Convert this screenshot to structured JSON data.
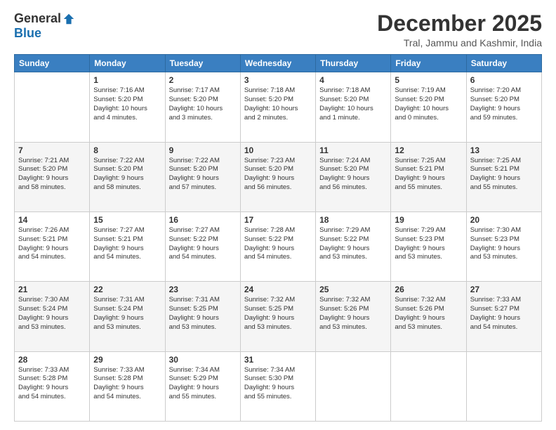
{
  "header": {
    "logo_general": "General",
    "logo_blue": "Blue",
    "month": "December 2025",
    "location": "Tral, Jammu and Kashmir, India"
  },
  "days_of_week": [
    "Sunday",
    "Monday",
    "Tuesday",
    "Wednesday",
    "Thursday",
    "Friday",
    "Saturday"
  ],
  "weeks": [
    [
      {
        "day": "",
        "info": ""
      },
      {
        "day": "1",
        "info": "Sunrise: 7:16 AM\nSunset: 5:20 PM\nDaylight: 10 hours\nand 4 minutes."
      },
      {
        "day": "2",
        "info": "Sunrise: 7:17 AM\nSunset: 5:20 PM\nDaylight: 10 hours\nand 3 minutes."
      },
      {
        "day": "3",
        "info": "Sunrise: 7:18 AM\nSunset: 5:20 PM\nDaylight: 10 hours\nand 2 minutes."
      },
      {
        "day": "4",
        "info": "Sunrise: 7:18 AM\nSunset: 5:20 PM\nDaylight: 10 hours\nand 1 minute."
      },
      {
        "day": "5",
        "info": "Sunrise: 7:19 AM\nSunset: 5:20 PM\nDaylight: 10 hours\nand 0 minutes."
      },
      {
        "day": "6",
        "info": "Sunrise: 7:20 AM\nSunset: 5:20 PM\nDaylight: 9 hours\nand 59 minutes."
      }
    ],
    [
      {
        "day": "7",
        "info": "Sunrise: 7:21 AM\nSunset: 5:20 PM\nDaylight: 9 hours\nand 58 minutes."
      },
      {
        "day": "8",
        "info": "Sunrise: 7:22 AM\nSunset: 5:20 PM\nDaylight: 9 hours\nand 58 minutes."
      },
      {
        "day": "9",
        "info": "Sunrise: 7:22 AM\nSunset: 5:20 PM\nDaylight: 9 hours\nand 57 minutes."
      },
      {
        "day": "10",
        "info": "Sunrise: 7:23 AM\nSunset: 5:20 PM\nDaylight: 9 hours\nand 56 minutes."
      },
      {
        "day": "11",
        "info": "Sunrise: 7:24 AM\nSunset: 5:20 PM\nDaylight: 9 hours\nand 56 minutes."
      },
      {
        "day": "12",
        "info": "Sunrise: 7:25 AM\nSunset: 5:21 PM\nDaylight: 9 hours\nand 55 minutes."
      },
      {
        "day": "13",
        "info": "Sunrise: 7:25 AM\nSunset: 5:21 PM\nDaylight: 9 hours\nand 55 minutes."
      }
    ],
    [
      {
        "day": "14",
        "info": "Sunrise: 7:26 AM\nSunset: 5:21 PM\nDaylight: 9 hours\nand 54 minutes."
      },
      {
        "day": "15",
        "info": "Sunrise: 7:27 AM\nSunset: 5:21 PM\nDaylight: 9 hours\nand 54 minutes."
      },
      {
        "day": "16",
        "info": "Sunrise: 7:27 AM\nSunset: 5:22 PM\nDaylight: 9 hours\nand 54 minutes."
      },
      {
        "day": "17",
        "info": "Sunrise: 7:28 AM\nSunset: 5:22 PM\nDaylight: 9 hours\nand 54 minutes."
      },
      {
        "day": "18",
        "info": "Sunrise: 7:29 AM\nSunset: 5:22 PM\nDaylight: 9 hours\nand 53 minutes."
      },
      {
        "day": "19",
        "info": "Sunrise: 7:29 AM\nSunset: 5:23 PM\nDaylight: 9 hours\nand 53 minutes."
      },
      {
        "day": "20",
        "info": "Sunrise: 7:30 AM\nSunset: 5:23 PM\nDaylight: 9 hours\nand 53 minutes."
      }
    ],
    [
      {
        "day": "21",
        "info": "Sunrise: 7:30 AM\nSunset: 5:24 PM\nDaylight: 9 hours\nand 53 minutes."
      },
      {
        "day": "22",
        "info": "Sunrise: 7:31 AM\nSunset: 5:24 PM\nDaylight: 9 hours\nand 53 minutes."
      },
      {
        "day": "23",
        "info": "Sunrise: 7:31 AM\nSunset: 5:25 PM\nDaylight: 9 hours\nand 53 minutes."
      },
      {
        "day": "24",
        "info": "Sunrise: 7:32 AM\nSunset: 5:25 PM\nDaylight: 9 hours\nand 53 minutes."
      },
      {
        "day": "25",
        "info": "Sunrise: 7:32 AM\nSunset: 5:26 PM\nDaylight: 9 hours\nand 53 minutes."
      },
      {
        "day": "26",
        "info": "Sunrise: 7:32 AM\nSunset: 5:26 PM\nDaylight: 9 hours\nand 53 minutes."
      },
      {
        "day": "27",
        "info": "Sunrise: 7:33 AM\nSunset: 5:27 PM\nDaylight: 9 hours\nand 54 minutes."
      }
    ],
    [
      {
        "day": "28",
        "info": "Sunrise: 7:33 AM\nSunset: 5:28 PM\nDaylight: 9 hours\nand 54 minutes."
      },
      {
        "day": "29",
        "info": "Sunrise: 7:33 AM\nSunset: 5:28 PM\nDaylight: 9 hours\nand 54 minutes."
      },
      {
        "day": "30",
        "info": "Sunrise: 7:34 AM\nSunset: 5:29 PM\nDaylight: 9 hours\nand 55 minutes."
      },
      {
        "day": "31",
        "info": "Sunrise: 7:34 AM\nSunset: 5:30 PM\nDaylight: 9 hours\nand 55 minutes."
      },
      {
        "day": "",
        "info": ""
      },
      {
        "day": "",
        "info": ""
      },
      {
        "day": "",
        "info": ""
      }
    ]
  ]
}
